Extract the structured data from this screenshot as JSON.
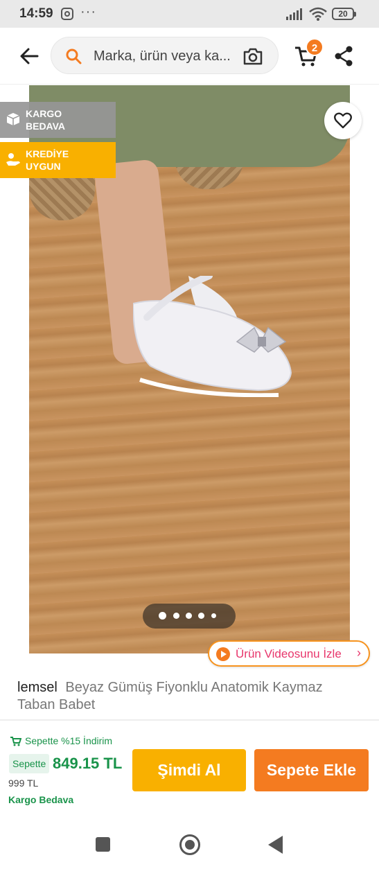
{
  "status_bar": {
    "time": "14:59",
    "more": "···",
    "battery": "20"
  },
  "header": {
    "search_placeholder": "Marka, ürün veya ka...",
    "cart_count": "2",
    "icons": [
      "back-arrow-icon",
      "search-icon",
      "camera-icon",
      "cart-icon",
      "share-icon"
    ]
  },
  "gallery": {
    "badges": [
      {
        "label": "KARGO BEDAVA",
        "icon": "box-icon",
        "color": "#969696"
      },
      {
        "label": "KREDİYE UYGUN",
        "icon": "hand-coin-icon",
        "color": "#f9b000"
      }
    ],
    "image_count": 5,
    "active_index": 0,
    "video_button": "Ürün Videosunu İzle"
  },
  "product": {
    "brand": "lemsel",
    "title": "Beyaz Gümüş Fiyonklu Anatomik Kaymaz Taban Babet"
  },
  "purchase": {
    "discount_note": "Sepette %15 İndirim",
    "price_tag": "Sepette",
    "price": "849.15 TL",
    "old_price": "999 TL",
    "shipping": "Kargo Bedava",
    "buy_now": "Şimdi Al",
    "add_to_cart": "Sepete Ekle"
  },
  "colors": {
    "accent_orange": "#f47b20",
    "accent_yellow": "#f9b000",
    "price_green": "#19934a",
    "video_pink": "#e8366c"
  }
}
